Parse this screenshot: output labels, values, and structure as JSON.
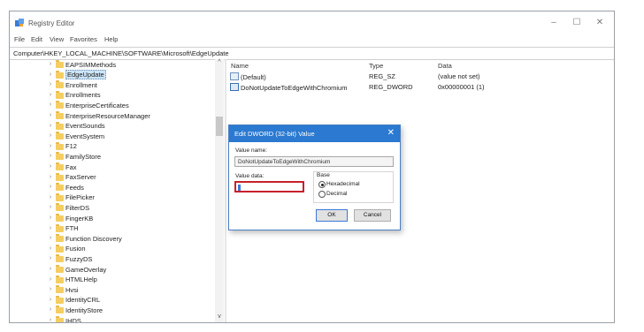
{
  "window": {
    "title": "Registry Editor",
    "controls": {
      "minimize": "–",
      "maximize": "☐",
      "close": "✕"
    }
  },
  "menu": [
    "File",
    "Edit",
    "View",
    "Favorites",
    "Help"
  ],
  "address": "Computer\\HKEY_LOCAL_MACHINE\\SOFTWARE\\Microsoft\\EdgeUpdate",
  "tree": {
    "items": [
      "EAPSIMMethods",
      "EdgeUpdate",
      "Enrollment",
      "Enrollments",
      "EnterpriseCertificates",
      "EnterpriseResourceManager",
      "EventSounds",
      "EventSystem",
      "F12",
      "FamilyStore",
      "Fax",
      "FaxServer",
      "Feeds",
      "FilePicker",
      "FilterDS",
      "FingerKB",
      "FTH",
      "Function Discovery",
      "Fusion",
      "FuzzyDS",
      "GameOverlay",
      "HTMLHelp",
      "Hvsi",
      "IdentityCRL",
      "IdentityStore",
      "IHDS"
    ],
    "selected_index": 1,
    "scroll_up": "^",
    "scroll_down": "v"
  },
  "values": {
    "columns": {
      "name": "Name",
      "type": "Type",
      "data": "Data"
    },
    "rows": [
      {
        "name": "(Default)",
        "type": "REG_SZ",
        "data": "(value not set)"
      },
      {
        "name": "DoNotUpdateToEdgeWithChromium",
        "type": "REG_DWORD",
        "data": "0x00000001 (1)"
      }
    ]
  },
  "dialog": {
    "title": "Edit DWORD (32-bit) Value",
    "close": "✕",
    "value_name_label": "Value name:",
    "value_name": "DoNotUpdateToEdgeWithChromium",
    "value_data_label": "Value data:",
    "value_data": "",
    "base_label": "Base",
    "hex_label": "Hexadecimal",
    "dec_label": "Decimal",
    "base_selected": "Hexadecimal",
    "ok": "OK",
    "cancel": "Cancel"
  },
  "colors": {
    "dialog_title": "#2b79d0",
    "highlight": "#c8202b",
    "folder": "#f5cd62"
  }
}
